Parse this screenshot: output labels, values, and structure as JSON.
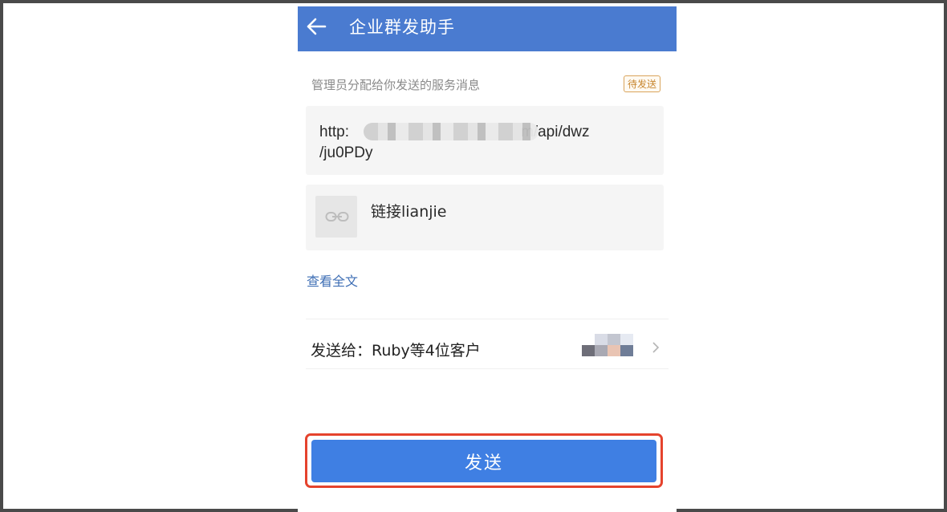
{
  "header": {
    "title": "企业群发助手",
    "back_icon": "arrow-left-icon"
  },
  "message": {
    "subtitle": "管理员分配给你发送的服务消息",
    "status_badge": "待发送",
    "url_prefix": "http:",
    "url_suffix": "m/api/dwz",
    "url_line2": "/ju0PDy",
    "link_title": "链接lianjie",
    "view_all": "查看全文"
  },
  "recipients": {
    "label": "发送给：Ruby等4位客户"
  },
  "actions": {
    "send_label": "发送"
  },
  "colors": {
    "header_bg": "#4a7bd0",
    "primary_button": "#3f7fe3",
    "highlight_outline": "#e5432d",
    "badge": "#c7862f",
    "link_text": "#3f6fb5"
  }
}
